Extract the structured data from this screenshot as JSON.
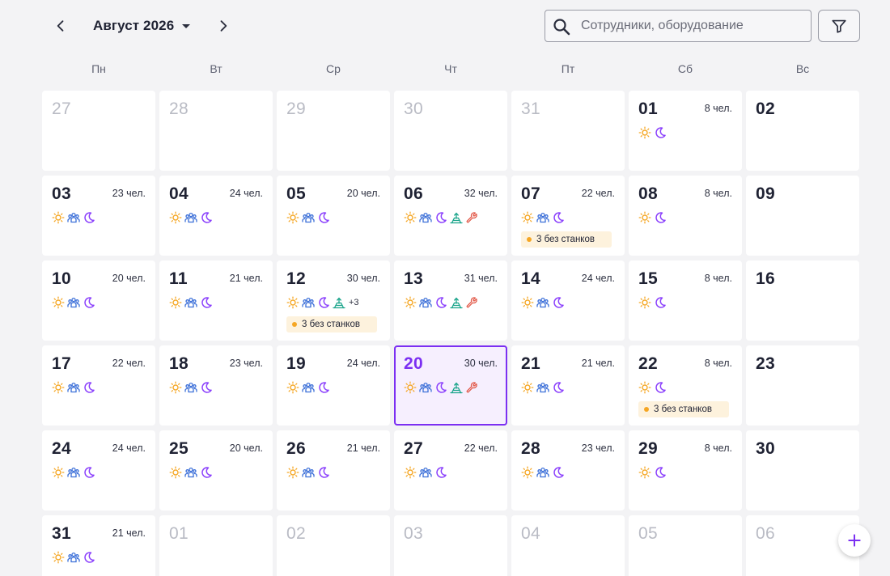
{
  "header": {
    "month_label": "Август 2026",
    "search_placeholder": "Сотрудники, оборудование"
  },
  "weekdays": [
    "Пн",
    "Вт",
    "Ср",
    "Чт",
    "Пт",
    "Сб",
    "Вс"
  ],
  "colors": {
    "accent": "#7b2ff2",
    "sun": "#f5a623",
    "group": "#3b6fd8",
    "moon": "#8a3ffc",
    "tool": "#19a48a",
    "wrench": "#e25a4a",
    "badge_dot": "#f5a623",
    "badge_bg": "#fdf2dd"
  },
  "legend_icons": {
    "sun": "sun-icon (day shift)",
    "group": "group-icon (team shift)",
    "moon": "moon-icon (night shift)",
    "tool": "machine-icon",
    "wrench": "wrench-icon"
  },
  "days": [
    {
      "num": "27",
      "other": true
    },
    {
      "num": "28",
      "other": true
    },
    {
      "num": "29",
      "other": true
    },
    {
      "num": "30",
      "other": true
    },
    {
      "num": "31",
      "other": true
    },
    {
      "num": "01",
      "count": "8 чел.",
      "icons": [
        "sun",
        "moon"
      ]
    },
    {
      "num": "02"
    },
    {
      "num": "03",
      "count": "23 чел.",
      "icons": [
        "sun",
        "group",
        "moon"
      ]
    },
    {
      "num": "04",
      "count": "24 чел.",
      "icons": [
        "sun",
        "group",
        "moon"
      ]
    },
    {
      "num": "05",
      "count": "20 чел.",
      "icons": [
        "sun",
        "group",
        "moon"
      ]
    },
    {
      "num": "06",
      "count": "32 чел.",
      "icons": [
        "sun",
        "group",
        "moon",
        "tool",
        "wrench"
      ]
    },
    {
      "num": "07",
      "count": "22 чел.",
      "icons": [
        "sun",
        "group",
        "moon"
      ],
      "badge": "3 без станков"
    },
    {
      "num": "08",
      "count": "8 чел.",
      "icons": [
        "sun",
        "moon"
      ]
    },
    {
      "num": "09"
    },
    {
      "num": "10",
      "count": "20 чел.",
      "icons": [
        "sun",
        "group",
        "moon"
      ]
    },
    {
      "num": "11",
      "count": "21 чел.",
      "icons": [
        "sun",
        "group",
        "moon"
      ]
    },
    {
      "num": "12",
      "count": "30 чел.",
      "icons": [
        "sun",
        "group",
        "moon",
        "tool"
      ],
      "more": "+3",
      "badge": "3 без станков"
    },
    {
      "num": "13",
      "count": "31 чел.",
      "icons": [
        "sun",
        "group",
        "moon",
        "tool",
        "wrench"
      ]
    },
    {
      "num": "14",
      "count": "24 чел.",
      "icons": [
        "sun",
        "group",
        "moon"
      ]
    },
    {
      "num": "15",
      "count": "8 чел.",
      "icons": [
        "sun",
        "moon"
      ]
    },
    {
      "num": "16"
    },
    {
      "num": "17",
      "count": "22 чел.",
      "icons": [
        "sun",
        "group",
        "moon"
      ]
    },
    {
      "num": "18",
      "count": "23 чел.",
      "icons": [
        "sun",
        "group",
        "moon"
      ]
    },
    {
      "num": "19",
      "count": "24 чел.",
      "icons": [
        "sun",
        "group",
        "moon"
      ]
    },
    {
      "num": "20",
      "count": "30 чел.",
      "icons": [
        "sun",
        "group",
        "moon",
        "tool",
        "wrench"
      ],
      "today": true
    },
    {
      "num": "21",
      "count": "21 чел.",
      "icons": [
        "sun",
        "group",
        "moon"
      ]
    },
    {
      "num": "22",
      "count": "8 чел.",
      "icons": [
        "sun",
        "moon"
      ],
      "badge": "3 без станков"
    },
    {
      "num": "23"
    },
    {
      "num": "24",
      "count": "24 чел.",
      "icons": [
        "sun",
        "group",
        "moon"
      ]
    },
    {
      "num": "25",
      "count": "20 чел.",
      "icons": [
        "sun",
        "group",
        "moon"
      ]
    },
    {
      "num": "26",
      "count": "21 чел.",
      "icons": [
        "sun",
        "group",
        "moon"
      ]
    },
    {
      "num": "27",
      "count": "22 чел.",
      "icons": [
        "sun",
        "group",
        "moon"
      ]
    },
    {
      "num": "28",
      "count": "23 чел.",
      "icons": [
        "sun",
        "group",
        "moon"
      ]
    },
    {
      "num": "29",
      "count": "8 чел.",
      "icons": [
        "sun",
        "moon"
      ]
    },
    {
      "num": "30"
    },
    {
      "num": "31",
      "count": "21 чел.",
      "icons": [
        "sun",
        "group",
        "moon"
      ]
    },
    {
      "num": "01",
      "other": true
    },
    {
      "num": "02",
      "other": true
    },
    {
      "num": "03",
      "other": true
    },
    {
      "num": "04",
      "other": true
    },
    {
      "num": "05",
      "other": true
    },
    {
      "num": "06",
      "other": true
    }
  ]
}
